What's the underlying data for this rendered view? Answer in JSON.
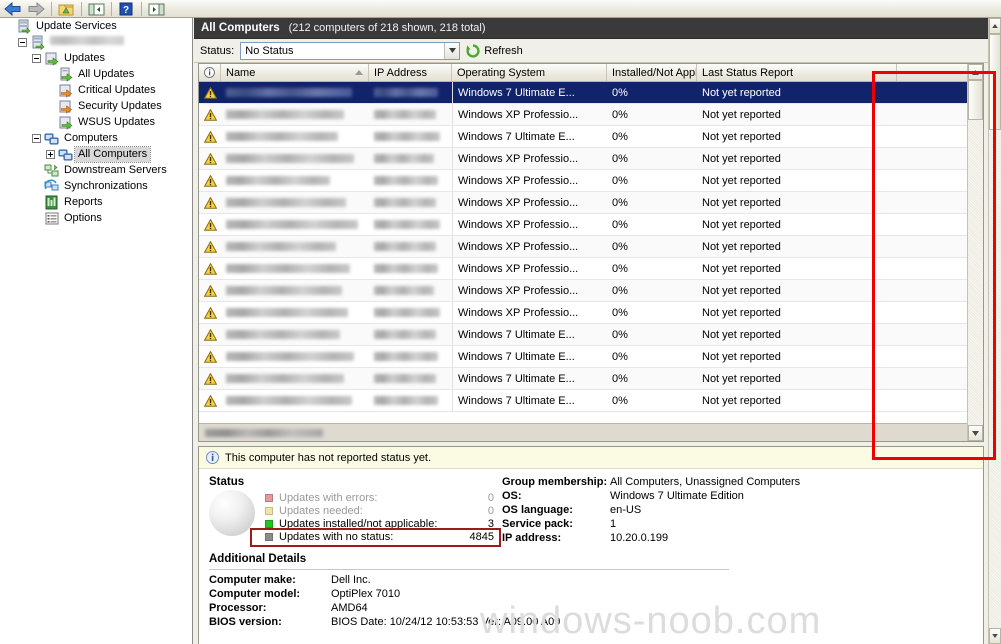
{
  "toolbar": {
    "buttons": [
      {
        "name": "back-button",
        "icon": "back-arrow-icon",
        "glyph": "⬅"
      },
      {
        "name": "forward-button",
        "icon": "forward-arrow-icon",
        "glyph": "➡"
      },
      {
        "name": "up-folder-button",
        "icon": "folder-up-icon",
        "glyph": "▰"
      },
      {
        "name": "show-tree-button",
        "icon": "panel-left-icon",
        "glyph": "◧"
      },
      {
        "name": "help-button",
        "icon": "help-icon",
        "glyph": "?"
      },
      {
        "name": "show-actions-button",
        "icon": "panel-right-icon",
        "glyph": "◨"
      }
    ]
  },
  "sidebar": {
    "items": [
      {
        "label": "Update Services",
        "icon": "update-services-icon",
        "indent": 0,
        "twisty": "none",
        "selected": false,
        "redacted": false
      },
      {
        "label": "",
        "icon": "server-icon",
        "indent": 1,
        "twisty": "minus",
        "selected": false,
        "redacted": true
      },
      {
        "label": "Updates",
        "icon": "updates-green-arrow-icon",
        "indent": 2,
        "twisty": "minus",
        "selected": false,
        "redacted": false
      },
      {
        "label": "All Updates",
        "icon": "all-updates-icon",
        "indent": 3,
        "twisty": "none",
        "selected": false,
        "redacted": false
      },
      {
        "label": "Critical Updates",
        "icon": "critical-updates-orange-arrow-icon",
        "indent": 3,
        "twisty": "none",
        "selected": false,
        "redacted": false
      },
      {
        "label": "Security Updates",
        "icon": "security-updates-orange-arrow-icon",
        "indent": 3,
        "twisty": "none",
        "selected": false,
        "redacted": false
      },
      {
        "label": "WSUS Updates",
        "icon": "wsus-updates-green-arrow-icon",
        "indent": 3,
        "twisty": "none",
        "selected": false,
        "redacted": false
      },
      {
        "label": "Computers",
        "icon": "computers-icon",
        "indent": 2,
        "twisty": "minus",
        "selected": false,
        "redacted": false
      },
      {
        "label": "All Computers",
        "icon": "all-computers-icon",
        "indent": 3,
        "twisty": "plus",
        "selected": true,
        "redacted": false
      },
      {
        "label": "Downstream Servers",
        "icon": "downstream-servers-icon",
        "indent": 2,
        "twisty": "none",
        "selected": false,
        "redacted": false
      },
      {
        "label": "Synchronizations",
        "icon": "synchronizations-icon",
        "indent": 2,
        "twisty": "none",
        "selected": false,
        "redacted": false
      },
      {
        "label": "Reports",
        "icon": "reports-icon",
        "indent": 2,
        "twisty": "none",
        "selected": false,
        "redacted": false
      },
      {
        "label": "Options",
        "icon": "options-icon",
        "indent": 2,
        "twisty": "none",
        "selected": false,
        "redacted": false
      }
    ]
  },
  "view": {
    "title": "All Computers",
    "subtitle": "(212 computers of 218 shown, 218 total)"
  },
  "filter": {
    "status_label": "Status:",
    "status_value": "No Status",
    "refresh_label": "Refresh",
    "refresh_icon": "refresh-icon"
  },
  "list": {
    "columns": [
      {
        "key": "icon",
        "label": "",
        "icon": "info-column-icon"
      },
      {
        "key": "name",
        "label": "Name",
        "sorted": "asc"
      },
      {
        "key": "ip",
        "label": "IP Address"
      },
      {
        "key": "os",
        "label": "Operating System"
      },
      {
        "key": "pct",
        "label": "Installed/Not Appli..."
      },
      {
        "key": "last",
        "label": "Last Status Report"
      }
    ],
    "rows": [
      {
        "icon": "warning-icon",
        "name": "",
        "ip": "",
        "os": "Windows 7 Ultimate E...",
        "pct": "0%",
        "last": "Not yet reported",
        "selected": true
      },
      {
        "icon": "warning-icon",
        "name": "",
        "ip": "",
        "os": "Windows XP Professio...",
        "pct": "0%",
        "last": "Not yet reported",
        "selected": false
      },
      {
        "icon": "warning-icon",
        "name": "",
        "ip": "",
        "os": "Windows 7 Ultimate E...",
        "pct": "0%",
        "last": "Not yet reported",
        "selected": false
      },
      {
        "icon": "warning-icon",
        "name": "",
        "ip": "",
        "os": "Windows XP Professio...",
        "pct": "0%",
        "last": "Not yet reported",
        "selected": false
      },
      {
        "icon": "warning-icon",
        "name": "",
        "ip": "",
        "os": "Windows XP Professio...",
        "pct": "0%",
        "last": "Not yet reported",
        "selected": false
      },
      {
        "icon": "warning-icon",
        "name": "",
        "ip": "",
        "os": "Windows XP Professio...",
        "pct": "0%",
        "last": "Not yet reported",
        "selected": false
      },
      {
        "icon": "warning-icon",
        "name": "",
        "ip": "",
        "os": "Windows XP Professio...",
        "pct": "0%",
        "last": "Not yet reported",
        "selected": false
      },
      {
        "icon": "warning-icon",
        "name": "",
        "ip": "",
        "os": "Windows XP Professio...",
        "pct": "0%",
        "last": "Not yet reported",
        "selected": false
      },
      {
        "icon": "warning-icon",
        "name": "",
        "ip": "",
        "os": "Windows XP Professio...",
        "pct": "0%",
        "last": "Not yet reported",
        "selected": false
      },
      {
        "icon": "warning-icon",
        "name": "",
        "ip": "",
        "os": "Windows XP Professio...",
        "pct": "0%",
        "last": "Not yet reported",
        "selected": false
      },
      {
        "icon": "warning-icon",
        "name": "",
        "ip": "",
        "os": "Windows XP Professio...",
        "pct": "0%",
        "last": "Not yet reported",
        "selected": false
      },
      {
        "icon": "warning-icon",
        "name": "",
        "ip": "",
        "os": "Windows 7 Ultimate E...",
        "pct": "0%",
        "last": "Not yet reported",
        "selected": false
      },
      {
        "icon": "warning-icon",
        "name": "",
        "ip": "",
        "os": "Windows 7 Ultimate E...",
        "pct": "0%",
        "last": "Not yet reported",
        "selected": false
      },
      {
        "icon": "warning-icon",
        "name": "",
        "ip": "",
        "os": "Windows 7 Ultimate E...",
        "pct": "0%",
        "last": "Not yet reported",
        "selected": false
      },
      {
        "icon": "warning-icon",
        "name": "",
        "ip": "",
        "os": "Windows 7 Ultimate E...",
        "pct": "0%",
        "last": "Not yet reported",
        "selected": false
      }
    ]
  },
  "details": {
    "info_message": "This computer has not reported status yet.",
    "info_icon": "info-icon",
    "status_title": "Status",
    "status_items": [
      {
        "label": "Updates with errors:",
        "value": "0",
        "color": "#e59a9a",
        "dim": true
      },
      {
        "label": "Updates needed:",
        "value": "0",
        "color": "#f2e3a8",
        "dim": true
      },
      {
        "label": "Updates installed/not applicable:",
        "value": "3",
        "color": "#22c322",
        "dim": false
      },
      {
        "label": "Updates with no status:",
        "value": "4845",
        "color": "#8c8c8c",
        "dim": false
      }
    ],
    "properties": [
      {
        "key": "Group membership:",
        "value": "All Computers, Unassigned Computers"
      },
      {
        "key": "OS:",
        "value": "Windows 7 Ultimate Edition"
      },
      {
        "key": "OS language:",
        "value": "en-US"
      },
      {
        "key": "Service pack:",
        "value": "1"
      },
      {
        "key": "IP address:",
        "value": "10.20.0.199"
      }
    ],
    "additional_title": "Additional Details",
    "additional": [
      {
        "key": "Computer make:",
        "value": "Dell Inc."
      },
      {
        "key": "Computer model:",
        "value": "OptiPlex 7010"
      },
      {
        "key": "Processor:",
        "value": "AMD64"
      },
      {
        "key": "BIOS version:",
        "value": "BIOS Date: 10/24/12 10:53:53 Ver: A09.00  A09"
      }
    ]
  },
  "watermark": {
    "text": "windows-noob.com"
  },
  "annotations": {
    "last_status_column_box_color": "#ee0000",
    "no_status_row_box_color": "#9e1b1b"
  }
}
